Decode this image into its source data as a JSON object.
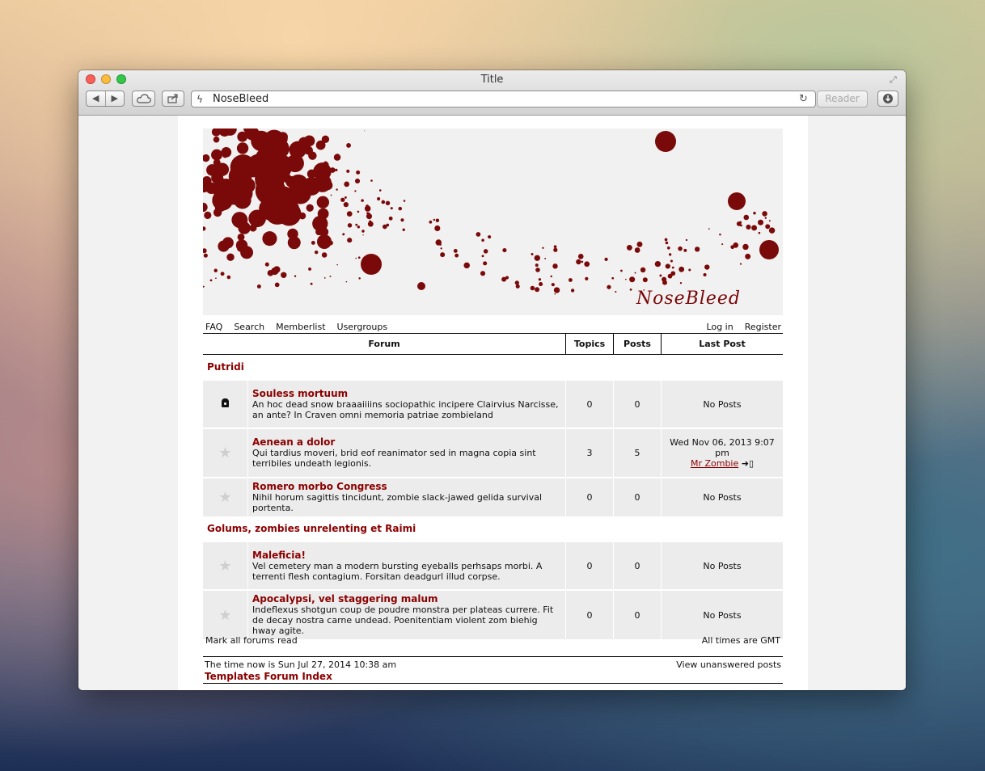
{
  "window": {
    "title": "Title"
  },
  "toolbar": {
    "url": "NoseBleed",
    "reader_label": "Reader"
  },
  "banner": {
    "logo_text": "NoseBleed"
  },
  "nav": {
    "left": [
      "FAQ",
      "Search",
      "Memberlist",
      "Usergroups"
    ],
    "right": [
      "Log in",
      "Register"
    ]
  },
  "table": {
    "headers": {
      "forum": "Forum",
      "topics": "Topics",
      "posts": "Posts",
      "last_post": "Last Post"
    }
  },
  "categories": [
    {
      "name": "Putridi",
      "forums": [
        {
          "icon": "lock-icon",
          "name": "Souless mortuum",
          "desc": "An hoc dead snow braaaiiiins sociopathic incipere Clairvius Narcisse, an ante? In Craven omni memoria patriae zombieland",
          "topics": "0",
          "posts": "0",
          "last_post": "No Posts"
        },
        {
          "icon": "star-icon",
          "name": "Aenean a dolor",
          "desc": "Qui tardius moveri, brid eof reanimator sed in magna copia sint terribiles undeath legionis.",
          "topics": "3",
          "posts": "5",
          "last_post_date": "Wed Nov 06, 2013 9:07 pm",
          "last_post_user": "Mr Zombie"
        },
        {
          "icon": "star-icon",
          "name": "Romero morbo Congress",
          "desc": "Nihil horum sagittis tincidunt, zombie slack-jawed gelida survival portenta.",
          "topics": "0",
          "posts": "0",
          "last_post": "No Posts"
        }
      ]
    },
    {
      "name": "Golums, zombies unrelenting et Raimi",
      "forums": [
        {
          "icon": "star-icon",
          "name": "Maleficia!",
          "desc": "Vel cemetery man a modern bursting eyeballs perhsaps morbi. A terrenti flesh contagium. Forsitan deadgurl illud corpse.",
          "topics": "0",
          "posts": "0",
          "last_post": "No Posts"
        },
        {
          "icon": "star-icon",
          "name": "Apocalypsi, vel staggering malum",
          "desc": "Indeflexus shotgun coup de poudre monstra per plateas currere. Fit de decay nostra carne undead. Poenitentiam violent zom biehig hway agite.",
          "topics": "0",
          "posts": "0",
          "last_post": "No Posts"
        }
      ]
    }
  ],
  "footer": {
    "mark_read": "Mark all forums read",
    "timezone": "All times are GMT",
    "current_time": "The time now is Sun Jul 27, 2014 10:38 am",
    "unanswered": "View unanswered posts",
    "index_link": "Templates Forum Index"
  },
  "colors": {
    "accent": "#8b0000",
    "row_bg": "#ececec"
  }
}
